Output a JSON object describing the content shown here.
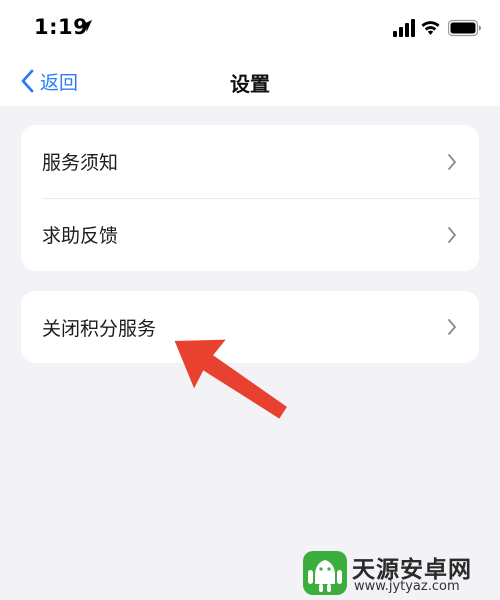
{
  "status_bar": {
    "time": "1:19"
  },
  "nav": {
    "back_label": "返回",
    "title": "设置"
  },
  "settings_groups": [
    {
      "items": [
        {
          "label": "服务须知"
        },
        {
          "label": "求助反馈"
        }
      ]
    },
    {
      "items": [
        {
          "label": "关闭积分服务"
        }
      ]
    }
  ],
  "annotation": {
    "icon": "red-arrow-icon",
    "color": "#e8412f"
  },
  "watermark": {
    "title": "天源安卓网",
    "url": "www.jytyaz.com",
    "logo_color": "#3cae3c"
  },
  "colors": {
    "accent": "#2d7cf6",
    "background": "#f2f2f7",
    "card": "#ffffff"
  }
}
